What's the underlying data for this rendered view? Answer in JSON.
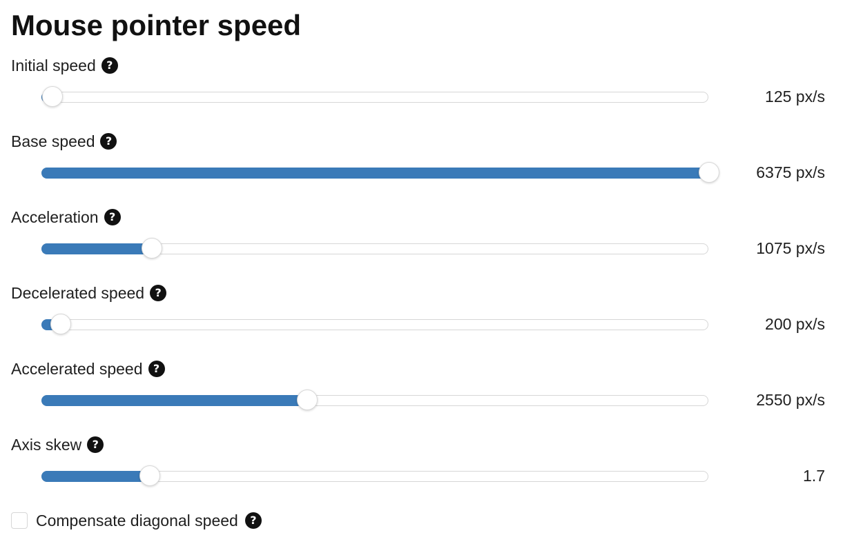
{
  "title": "Mouse pointer speed",
  "help_glyph": "?",
  "settings": [
    {
      "label": "Initial speed",
      "value_text": "125 px/s",
      "fraction": 0.016,
      "icon": "help-icon"
    },
    {
      "label": "Base speed",
      "value_text": "6375 px/s",
      "fraction": 1.0,
      "icon": "help-icon"
    },
    {
      "label": "Acceleration",
      "value_text": "1075 px/s",
      "fraction": 0.165,
      "icon": "help-icon"
    },
    {
      "label": "Decelerated speed",
      "value_text": "200 px/s",
      "fraction": 0.028,
      "icon": "help-icon"
    },
    {
      "label": "Accelerated speed",
      "value_text": "2550 px/s",
      "fraction": 0.398,
      "icon": "help-icon"
    },
    {
      "label": "Axis skew",
      "value_text": "1.7",
      "fraction": 0.162,
      "icon": "help-icon"
    }
  ],
  "checkbox": {
    "label": "Compensate diagonal speed",
    "checked": false,
    "icon": "help-icon"
  },
  "colors": {
    "accent": "#3a7ab8",
    "track_border": "#d6d6d6",
    "help_icon_bg": "#111111"
  }
}
